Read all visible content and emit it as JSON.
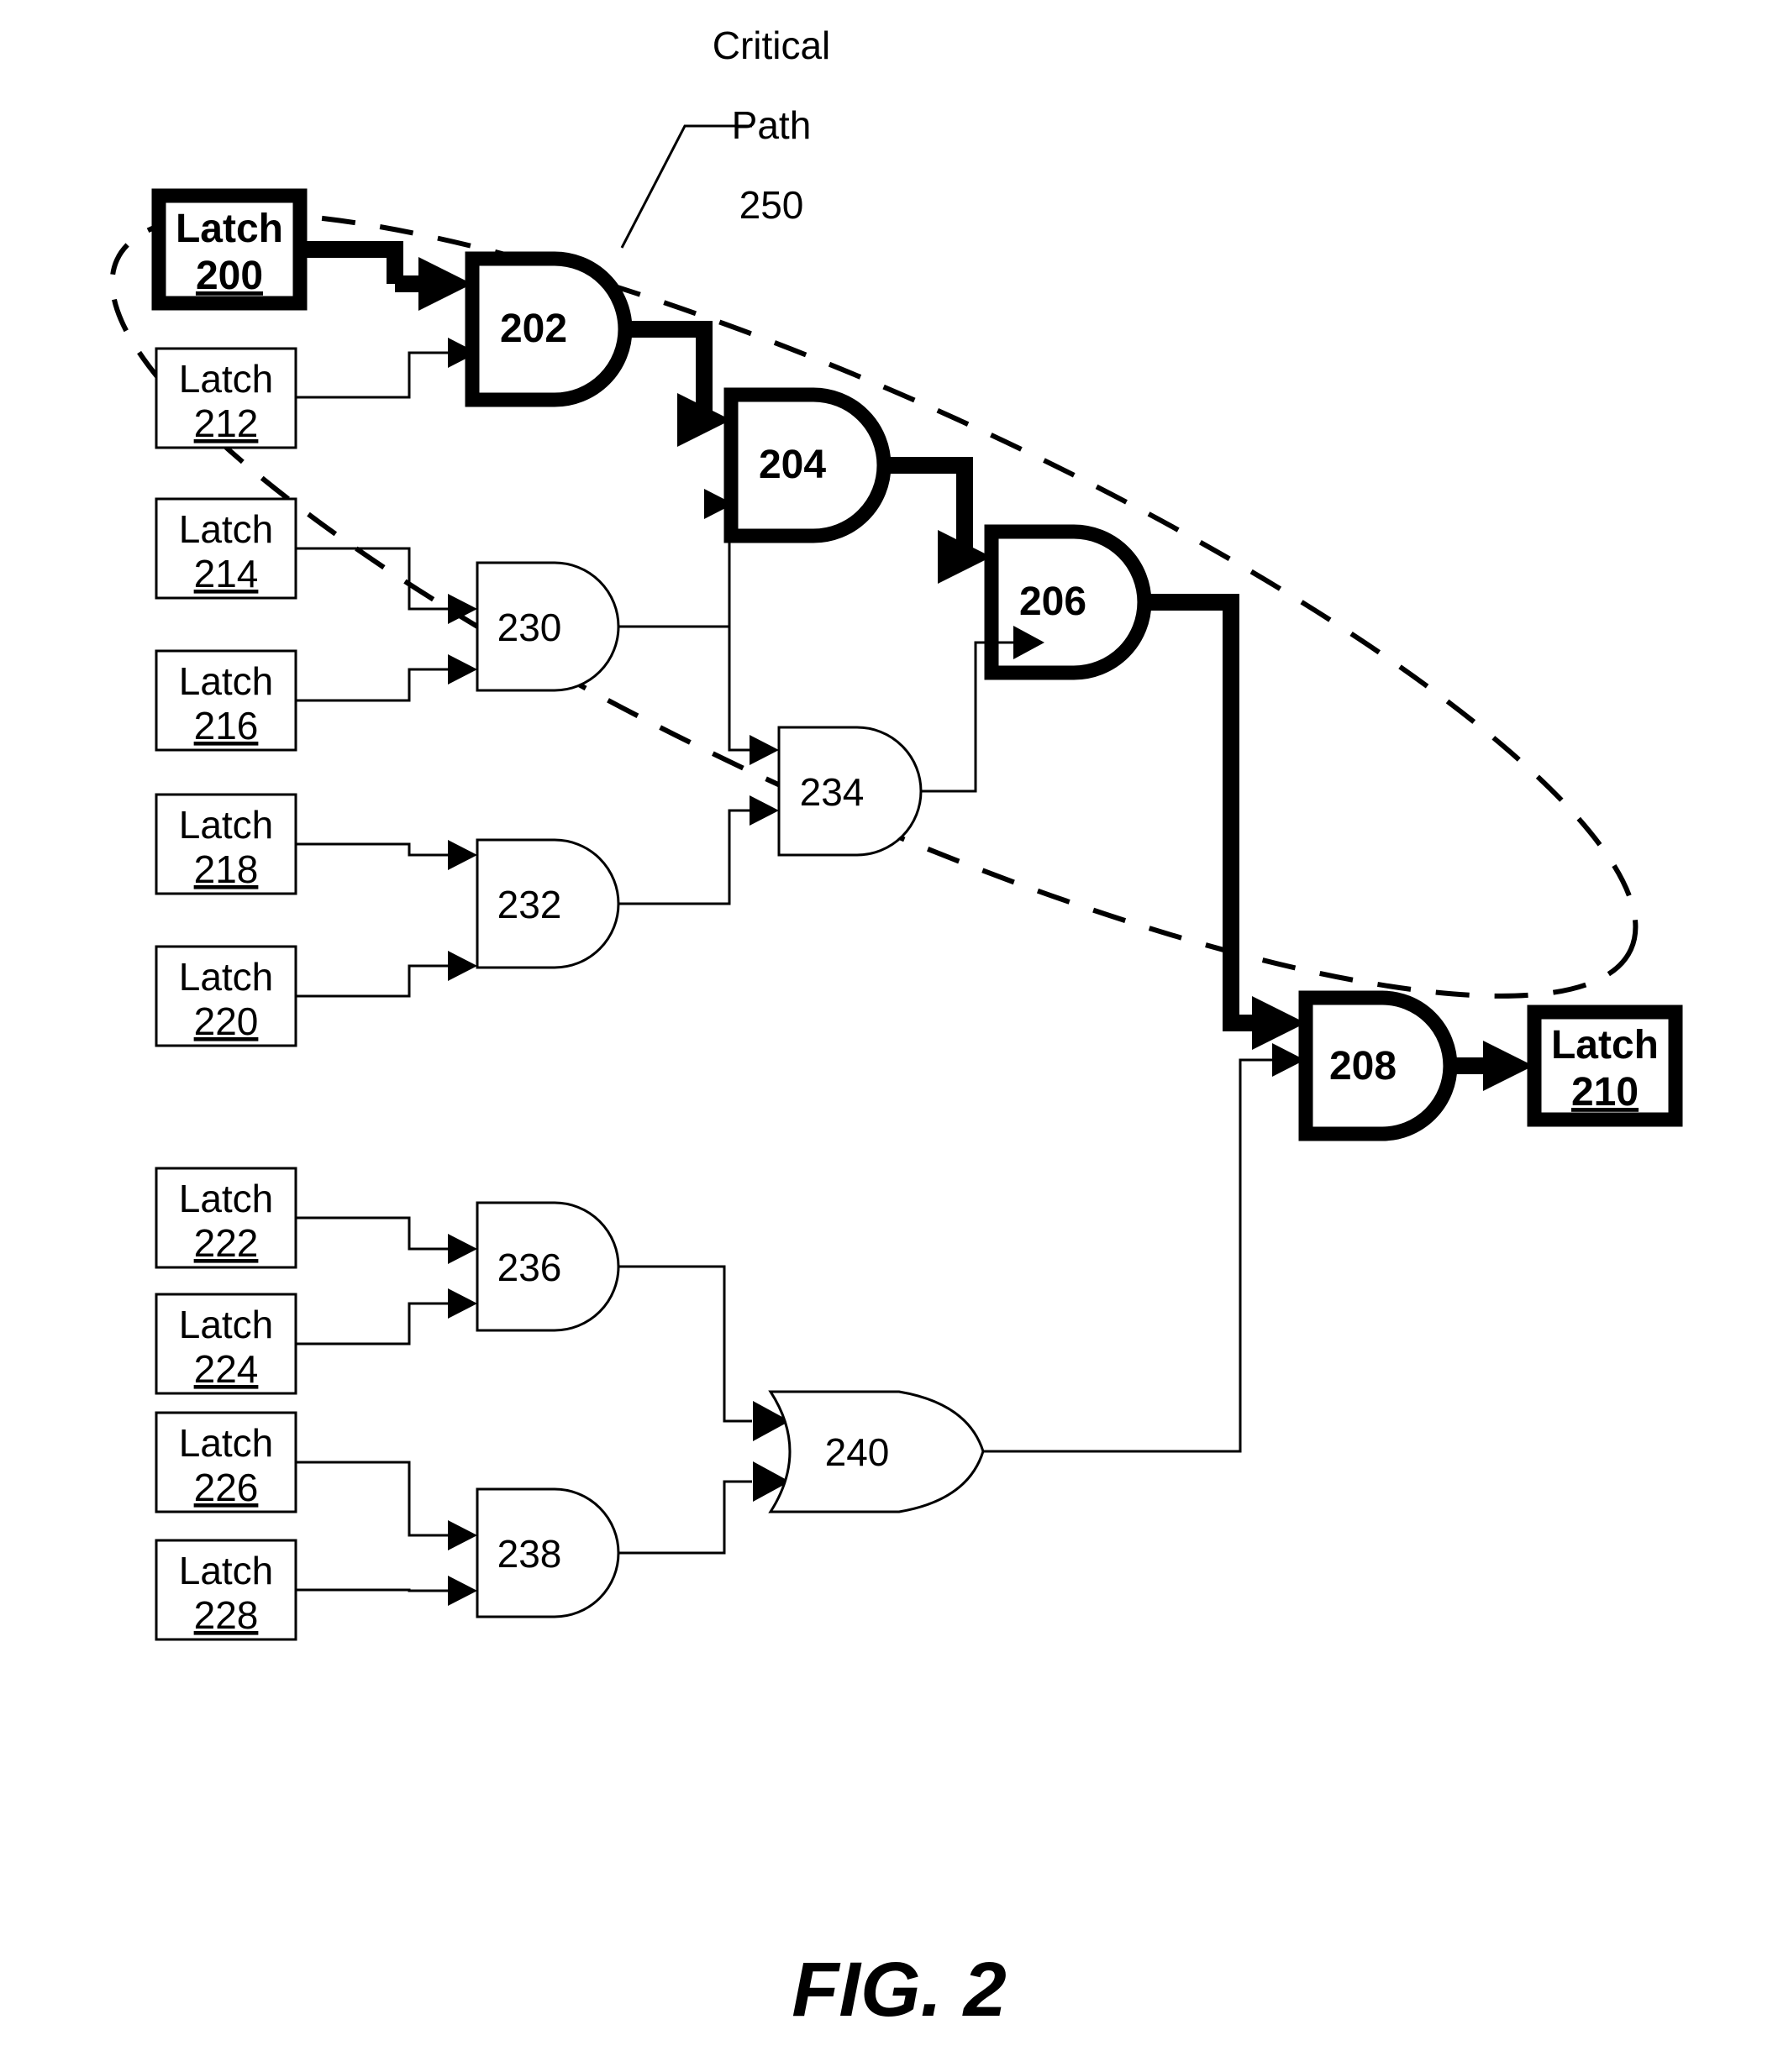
{
  "figure": {
    "label": "FIG. 2",
    "annotation": {
      "line1": "Critical",
      "line2": "Path",
      "line3": "250"
    }
  },
  "latches": [
    {
      "id": "latch-200",
      "label": "Latch",
      "number": "200",
      "critical": true
    },
    {
      "id": "latch-212",
      "label": "Latch",
      "number": "212",
      "critical": false
    },
    {
      "id": "latch-214",
      "label": "Latch",
      "number": "214",
      "critical": false
    },
    {
      "id": "latch-216",
      "label": "Latch",
      "number": "216",
      "critical": false
    },
    {
      "id": "latch-218",
      "label": "Latch",
      "number": "218",
      "critical": false
    },
    {
      "id": "latch-220",
      "label": "Latch",
      "number": "220",
      "critical": false
    },
    {
      "id": "latch-222",
      "label": "Latch",
      "number": "222",
      "critical": false
    },
    {
      "id": "latch-224",
      "label": "Latch",
      "number": "224",
      "critical": false
    },
    {
      "id": "latch-226",
      "label": "Latch",
      "number": "226",
      "critical": false
    },
    {
      "id": "latch-228",
      "label": "Latch",
      "number": "228",
      "critical": false
    },
    {
      "id": "latch-210",
      "label": "Latch",
      "number": "210",
      "critical": true
    }
  ],
  "gates": [
    {
      "id": "gate-202",
      "number": "202",
      "type": "and",
      "critical": true
    },
    {
      "id": "gate-204",
      "number": "204",
      "type": "and",
      "critical": true
    },
    {
      "id": "gate-206",
      "number": "206",
      "type": "and",
      "critical": true
    },
    {
      "id": "gate-208",
      "number": "208",
      "type": "and",
      "critical": true
    },
    {
      "id": "gate-230",
      "number": "230",
      "type": "and",
      "critical": false
    },
    {
      "id": "gate-232",
      "number": "232",
      "type": "and",
      "critical": false
    },
    {
      "id": "gate-234",
      "number": "234",
      "type": "and",
      "critical": false
    },
    {
      "id": "gate-236",
      "number": "236",
      "type": "and",
      "critical": false
    },
    {
      "id": "gate-238",
      "number": "238",
      "type": "and",
      "critical": false
    },
    {
      "id": "gate-240",
      "number": "240",
      "type": "or",
      "critical": false
    }
  ],
  "colors": {
    "ink": "#000000",
    "paper": "#ffffff"
  }
}
